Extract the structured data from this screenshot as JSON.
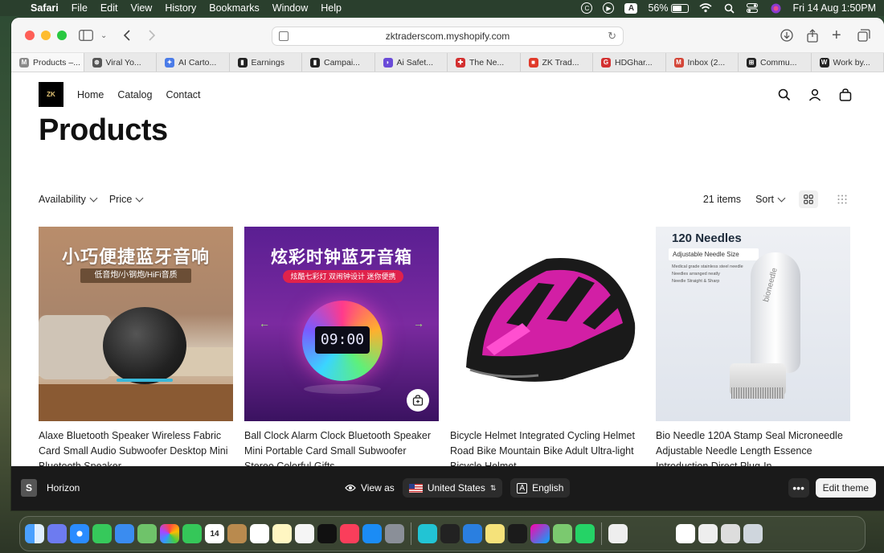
{
  "menubar": {
    "app": "Safari",
    "items": [
      "File",
      "Edit",
      "View",
      "History",
      "Bookmarks",
      "Window",
      "Help"
    ],
    "battery": "56%",
    "battery_level": 0.56,
    "datetime": "Fri 14 Aug  1:50PM"
  },
  "browser": {
    "url": "zktraderscom.myshopify.com",
    "tabs": [
      {
        "label": "Products –...",
        "color": "#8a8a8a",
        "glyph": "M"
      },
      {
        "label": "Viral Yo...",
        "color": "#555555",
        "glyph": "⊛"
      },
      {
        "label": "AI Carto...",
        "color": "#4a7be8",
        "glyph": "✦"
      },
      {
        "label": "Earnings",
        "color": "#222222",
        "glyph": "▮"
      },
      {
        "label": "Campai...",
        "color": "#222222",
        "glyph": "▮"
      },
      {
        "label": "Ai Safet...",
        "color": "#6a4bd8",
        "glyph": "◗"
      },
      {
        "label": "The Ne...",
        "color": "#d33030",
        "glyph": "✚"
      },
      {
        "label": "ZK Trad...",
        "color": "#e03a2a",
        "glyph": "■"
      },
      {
        "label": "HDGhar...",
        "color": "#d33030",
        "glyph": "G"
      },
      {
        "label": "Inbox (2...",
        "color": "#d44638",
        "glyph": "M"
      },
      {
        "label": "Commu...",
        "color": "#222222",
        "glyph": "⊞"
      },
      {
        "label": "Work by...",
        "color": "#222222",
        "glyph": "W"
      }
    ]
  },
  "store": {
    "logo": "ZK",
    "nav": [
      "Home",
      "Catalog",
      "Contact"
    ],
    "page_title": "Products",
    "filters": [
      "Availability",
      "Price"
    ],
    "item_count": "21 items",
    "sort_label": "Sort"
  },
  "products": [
    {
      "title": "Alaxe Bluetooth Speaker Wireless Fabric Card Small Audio Subwoofer Desktop Mini Bluetooth Speaker",
      "image_text": "小巧便捷蓝牙音响",
      "image_subtext": "低音炮/小钢炮/HiFi音质"
    },
    {
      "title": "Ball Clock Alarm Clock Bluetooth Speaker Mini Portable Card Small Subwoofer Stereo Colorful Gifts",
      "image_text": "炫彩时钟蓝牙音箱",
      "image_subtext": "炫酷七彩灯 双闹钟设计 迷你便携",
      "clock": "09:00"
    },
    {
      "title": "Bicycle Helmet Integrated Cycling Helmet Road Bike Mountain Bike Adult Ultra-light Bicycle Helmet"
    },
    {
      "title": "Bio Needle 120A Stamp Seal Microneedle Adjustable Needle Length Essence Introduction Direct Plug-In",
      "image_text": "120 Needles",
      "image_subtext": "Adjustable Needle Size",
      "image_notes": [
        "Medical grade stainless steel needle",
        "Needles arranged neatly",
        "Needle Straight & Sharp"
      ],
      "brand": "bioneedle"
    }
  ],
  "preview_bar": {
    "theme": "Horizon",
    "view_as": "View as",
    "country": "United States",
    "language": "English",
    "edit": "Edit theme"
  }
}
